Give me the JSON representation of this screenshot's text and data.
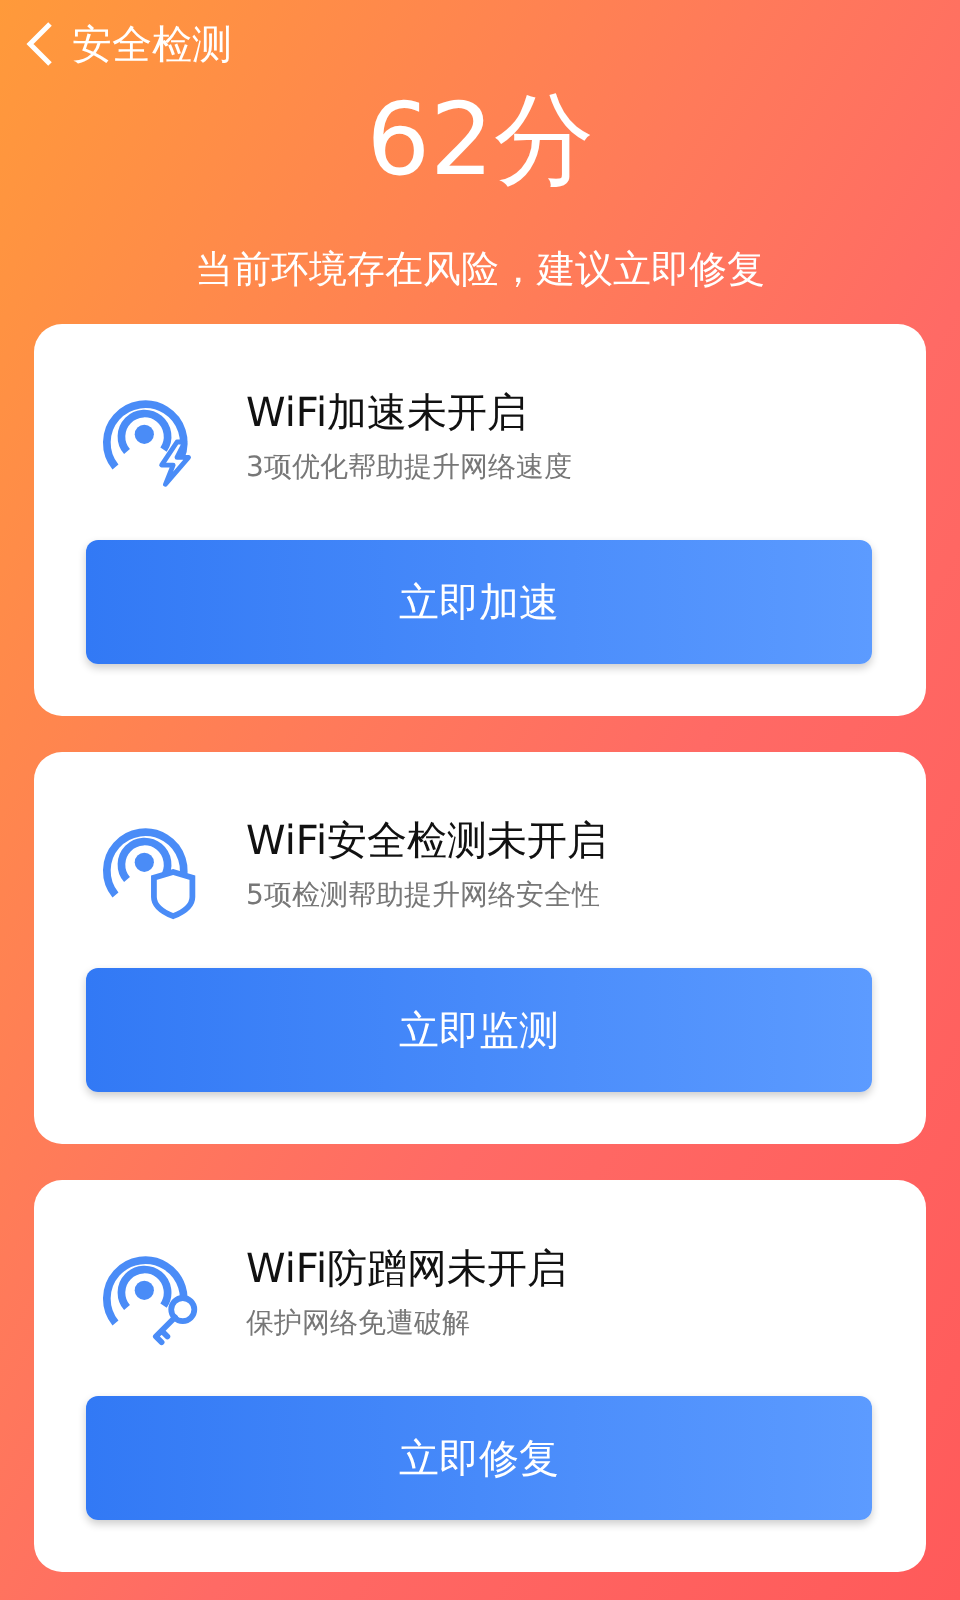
{
  "header": {
    "title": "安全检测"
  },
  "score": "62分",
  "message": "当前环境存在风险，建议立即修复",
  "cards": [
    {
      "kind": "bolt",
      "title": "WiFi加速未开启",
      "subtitle": "3项优化帮助提升网络速度",
      "button": "立即加速"
    },
    {
      "kind": "shield",
      "title": "WiFi安全检测未开启",
      "subtitle": "5项检测帮助提升网络安全性",
      "button": "立即监测"
    },
    {
      "kind": "key",
      "title": "WiFi防蹭网未开启",
      "subtitle": "保护网络免遭破解",
      "button": "立即修复"
    }
  ]
}
